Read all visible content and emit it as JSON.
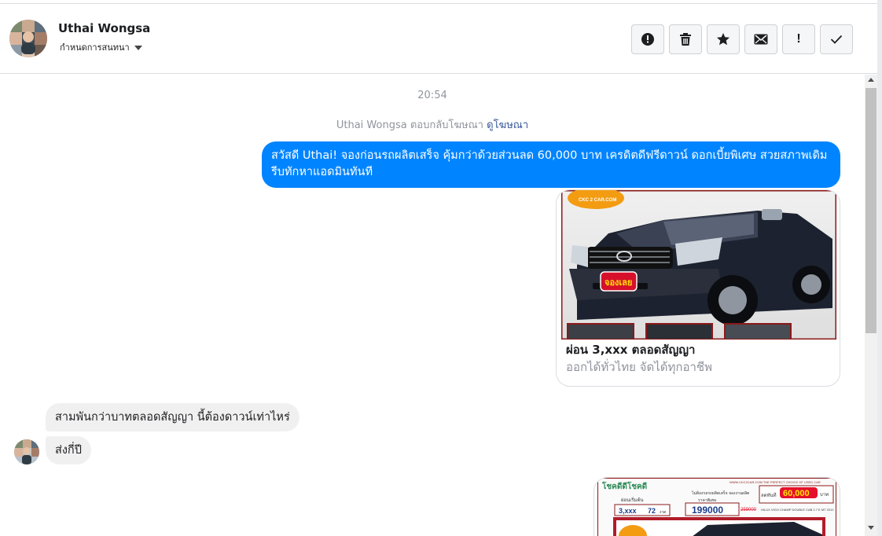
{
  "header": {
    "contact_name": "Uthai Wongsa",
    "assign_label": "กำหนดการสนทนา"
  },
  "toolbar": {
    "buttons": [
      {
        "name": "mark-spam-button",
        "icon": "alert-circle-icon"
      },
      {
        "name": "delete-button",
        "icon": "trash-icon"
      },
      {
        "name": "star-button",
        "icon": "star-icon"
      },
      {
        "name": "mark-unread-button",
        "icon": "envelope-icon"
      },
      {
        "name": "follow-up-button",
        "icon": "exclamation-icon",
        "label": "!"
      },
      {
        "name": "mark-done-button",
        "icon": "check-icon"
      }
    ]
  },
  "thread": {
    "timestamp": "20:54",
    "ad_reply_text": "Uthai Wongsa ตอบกลับโฆษณา",
    "ad_link_text": "ดูโฆษณา",
    "outgoing_message": "สวัสดี Uthai! จองก่อนรถผลิตเสร็จ คุ้มกว่าด้วยส่วนลด 60,000 บาท เครดิตดีฟรีดาวน์ ดอกเบี้ยพิเศษ สวยสภาพเดิม รีบทักหาแอดมินทันที",
    "ad_card": {
      "logo_text": "CKC 2 CAR.COM",
      "badge_text": "จองเลย",
      "title": "ผ่อน 3,xxx ตลอดสัญญา",
      "subtitle": "ออกได้ทั่วไทย จัดได้ทุกอาชีพ"
    },
    "incoming_messages": [
      "สามพันกว่าบาทตลอดสัญญา นี้ต้องดาวน์เท่าไหร่",
      "ส่งกี่ปี"
    ],
    "ad_card2": {
      "header_text": "โชคดีดีโชคดี",
      "site_text": "WWW.CKC2CAR.COM THE PERFECT CHOICE OF USED CAR",
      "discount_label": "ลดทันที",
      "discount_value": "60,000",
      "discount_unit": "บาท",
      "promo_line": "ไม่ต้องรอรถผลิตเสร็จ จองงานผลิต",
      "start_label": "ผ่อนเริ่มต้น",
      "installment": "3,xxx",
      "term": "72",
      "term_unit": "งวด",
      "price_label": "ราคาพิเศษ",
      "price": "199000",
      "old_price": "259000",
      "model_text": "HILUX VIGO CHAMP DOUBLE CAB 2.7 E MT 2012"
    }
  },
  "colors": {
    "messenger_blue": "#0084ff",
    "bubble_gray": "#f1f0f0",
    "muted_text": "#90949c",
    "link": "#385898"
  }
}
